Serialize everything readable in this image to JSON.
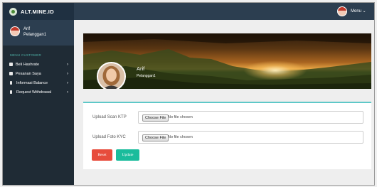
{
  "brand": {
    "name": "ALT.MINE.ID",
    "icon": "mine-logo-icon"
  },
  "user": {
    "name": "Arif",
    "role": "Pelanggan1"
  },
  "sidebar": {
    "section_header": "MENU CUSTOMER",
    "items": [
      {
        "label": "Beli Hashrate",
        "icon": "cart-icon"
      },
      {
        "label": "Pesanan Saya",
        "icon": "list-icon"
      },
      {
        "label": "Informasi Balance",
        "icon": "dollar-icon"
      },
      {
        "label": "Request Withdrawal",
        "icon": "dollar-icon"
      }
    ],
    "arrow": "›"
  },
  "topbar": {
    "menu_label": "Menu ⌄"
  },
  "profile": {
    "name": "Arif",
    "role": "Pelanggan1"
  },
  "form": {
    "fields": [
      {
        "label": "Upload Scan KTP",
        "button": "Choose File",
        "status": "No file chosen"
      },
      {
        "label": "Upload Foto KYC",
        "button": "Choose File",
        "status": "No file chosen"
      }
    ],
    "reset_label": "Reset",
    "update_label": "Update"
  },
  "colors": {
    "sidebar_bg": "#1f2b35",
    "topbar_bg": "#2c3e50",
    "accent_teal": "#1abc9c",
    "danger_red": "#e74c3c"
  }
}
